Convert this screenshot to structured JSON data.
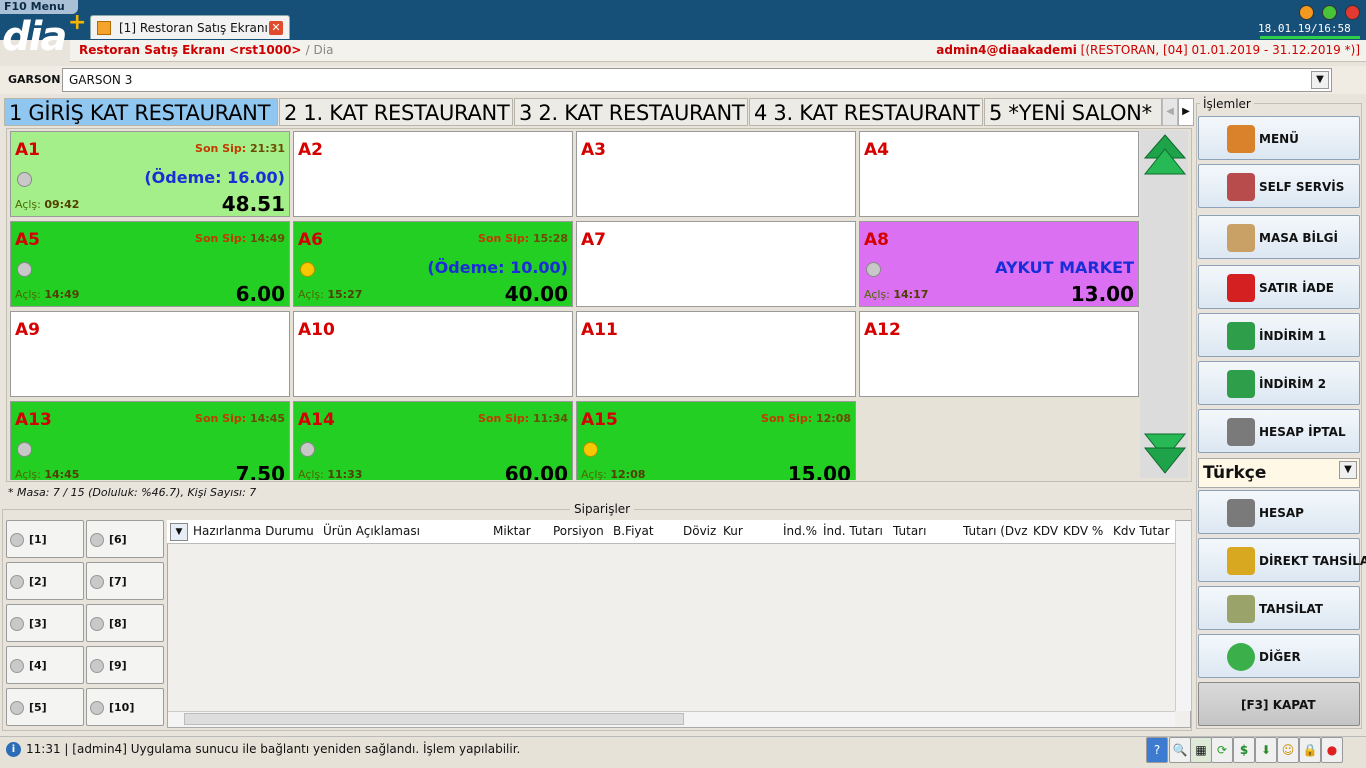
{
  "menu_label": "F10 Menu",
  "logo": "dia",
  "tab": {
    "label": "[1] Restoran Satış Ekranı"
  },
  "datetime": "18.01.19/16:58",
  "title": {
    "main": "Restoran Satış Ekranı <rst1000>",
    "sub": "/ Dia",
    "user": "admin4@diaakademi",
    "context": "[(RESTORAN, [04] 01.01.2019 - 31.12.2019 *)]"
  },
  "garson": {
    "label": "GARSON",
    "value": "GARSON 3"
  },
  "salons": [
    "1 GİRİŞ KAT RESTAURANT",
    "2 1. KAT RESTAURANT",
    "3 2. KAT RESTAURANT",
    "4 3. KAT RESTAURANT",
    "5 *YENİ SALON*"
  ],
  "colors": {
    "occupied": "#23cf23",
    "selected": "#a5ef8a",
    "customer": "#db70f2",
    "empty": "#ffffff",
    "table_name": "#d50000"
  },
  "tables": [
    {
      "name": "A1",
      "state": "selected",
      "last_label": "Son Sip:",
      "last": "21:31",
      "payment": "(Ödeme: 16.00)",
      "open_label": "Açlş:",
      "open": "09:42",
      "total": "48.51",
      "dot": "gray"
    },
    {
      "name": "A2",
      "state": "empty"
    },
    {
      "name": "A3",
      "state": "empty"
    },
    {
      "name": "A4",
      "state": "empty"
    },
    {
      "name": "A5",
      "state": "occupied",
      "last_label": "Son Sip:",
      "last": "14:49",
      "open_label": "Açlş:",
      "open": "14:49",
      "total": "6.00",
      "dot": "gray"
    },
    {
      "name": "A6",
      "state": "occupied",
      "last_label": "Son Sip:",
      "last": "15:28",
      "payment": "(Ödeme: 10.00)",
      "open_label": "Açlş:",
      "open": "15:27",
      "total": "40.00",
      "dot": "yellow"
    },
    {
      "name": "A7",
      "state": "empty"
    },
    {
      "name": "A8",
      "state": "customer",
      "payment": "AYKUT MARKET",
      "open_label": "Açlş:",
      "open": "14:17",
      "total": "13.00",
      "dot": "gray"
    },
    {
      "name": "A9",
      "state": "empty"
    },
    {
      "name": "A10",
      "state": "empty"
    },
    {
      "name": "A11",
      "state": "empty"
    },
    {
      "name": "A12",
      "state": "empty"
    },
    {
      "name": "A13",
      "state": "occupied",
      "last_label": "Son Sip:",
      "last": "14:45",
      "open_label": "Açlş:",
      "open": "14:45",
      "total": "7.50",
      "dot": "gray"
    },
    {
      "name": "A14",
      "state": "occupied",
      "last_label": "Son Sip:",
      "last": "11:34",
      "open_label": "Açlş:",
      "open": "11:33",
      "total": "60.00",
      "dot": "gray"
    },
    {
      "name": "A15",
      "state": "occupied",
      "last_label": "Son Sip:",
      "last": "12:08",
      "open_label": "Açlş:",
      "open": "12:08",
      "total": "15.00",
      "dot": "yellow"
    }
  ],
  "summary": "* Masa: 7 / 15 (Doluluk: %46.7), Kişi Sayısı: 7",
  "orders": {
    "label": "Siparişler",
    "buttons": [
      "[1]",
      "[2]",
      "[3]",
      "[4]",
      "[5]",
      "[6]",
      "[7]",
      "[8]",
      "[9]",
      "[10]"
    ],
    "columns": [
      "Hazırlanma Durumu",
      "Ürün Açıklaması",
      "Miktar",
      "Porsiyon",
      "B.Fiyat",
      "Döviz",
      "Kur",
      "İnd.%",
      "İnd. Tutarı",
      "Tutarı",
      "Tutarı (Dvz",
      "KDV",
      "KDV %",
      "Kdv Tutar"
    ]
  },
  "actions": {
    "label": "İşlemler",
    "top": [
      {
        "label": "MENÜ",
        "icon": "chicken-icon"
      },
      {
        "label": "SELF SERVİS",
        "icon": "basket-icon"
      },
      {
        "label": "MASA BİLGİ",
        "icon": "people-icon"
      },
      {
        "label": "SATIR İADE",
        "icon": "recycle-bin-icon"
      },
      {
        "label": "İNDİRİM 1",
        "icon": "percent-icon"
      },
      {
        "label": "İNDİRİM 2",
        "icon": "dollar-icon"
      },
      {
        "label": "HESAP İPTAL",
        "icon": "printer-cancel-icon"
      }
    ],
    "language": "Türkçe",
    "bottom": [
      {
        "label": "HESAP",
        "icon": "printer-icon"
      },
      {
        "label": "DİREKT  TAHSİLAT",
        "icon": "coins-icon"
      },
      {
        "label": "TAHSİLAT",
        "icon": "money-icon"
      },
      {
        "label": "DİĞER",
        "icon": "arrow-right-icon"
      },
      {
        "label": "[F3] KAPAT",
        "icon": ""
      }
    ]
  },
  "status": {
    "time": "11:31",
    "text": "| [admin4] Uygulama sunucu ile bağlantı yeniden sağlandı. İşlem yapılabilir."
  }
}
